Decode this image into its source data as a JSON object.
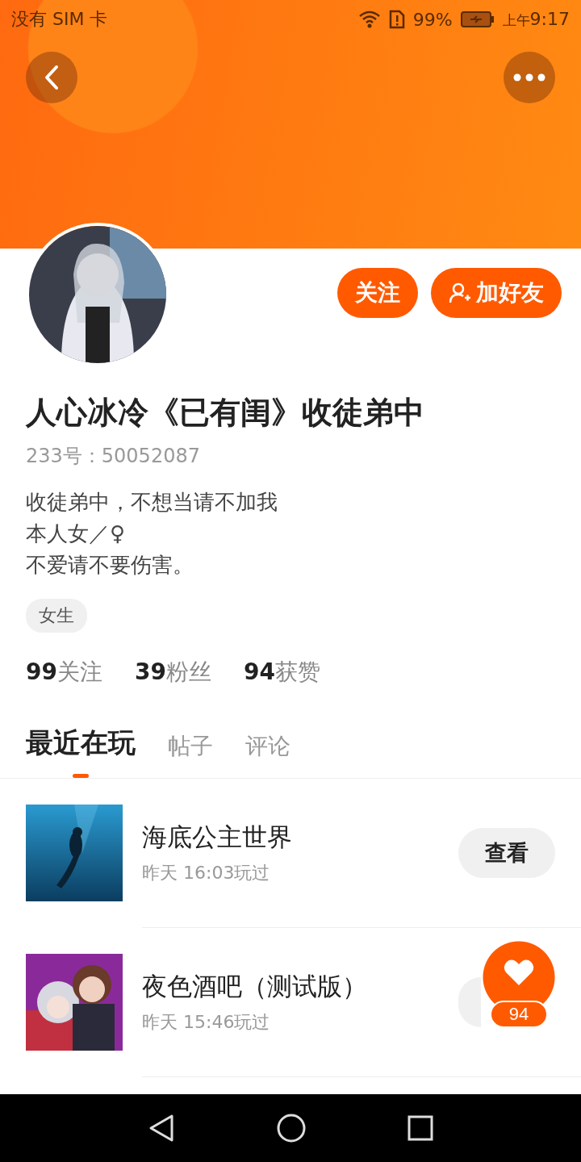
{
  "status_bar": {
    "carrier": "没有 SIM 卡",
    "battery": "99%",
    "time_prefix": "上午",
    "time": "9:17"
  },
  "profile": {
    "name": "人心冰冷《已有闺》收徒弟中",
    "id_line": "233号：50052087",
    "bio": [
      "收徒弟中，不想当请不加我",
      "本人女／♀",
      "不爱请不要伤害。"
    ],
    "tags": [
      "女生"
    ],
    "stats": [
      {
        "count": "99",
        "label": "关注"
      },
      {
        "count": "39",
        "label": "粉丝"
      },
      {
        "count": "94",
        "label": "获赞"
      }
    ],
    "buttons": [
      {
        "kind": "plain",
        "label": "关注"
      },
      {
        "kind": "friend",
        "label": "加好友"
      }
    ]
  },
  "tabs": [
    {
      "label": "最近在玩",
      "selected": true
    },
    {
      "label": "帖子",
      "selected": false
    },
    {
      "label": "评论",
      "selected": false
    }
  ],
  "games": [
    {
      "title": "海底公主世界",
      "played": "昨天 16:03玩过",
      "button": "查看",
      "kind": "sea"
    },
    {
      "title": "夜色酒吧（测试版）",
      "played": "昨天 15:46玩过",
      "kind": "bar"
    }
  ],
  "like_badge": {
    "count": "94"
  }
}
